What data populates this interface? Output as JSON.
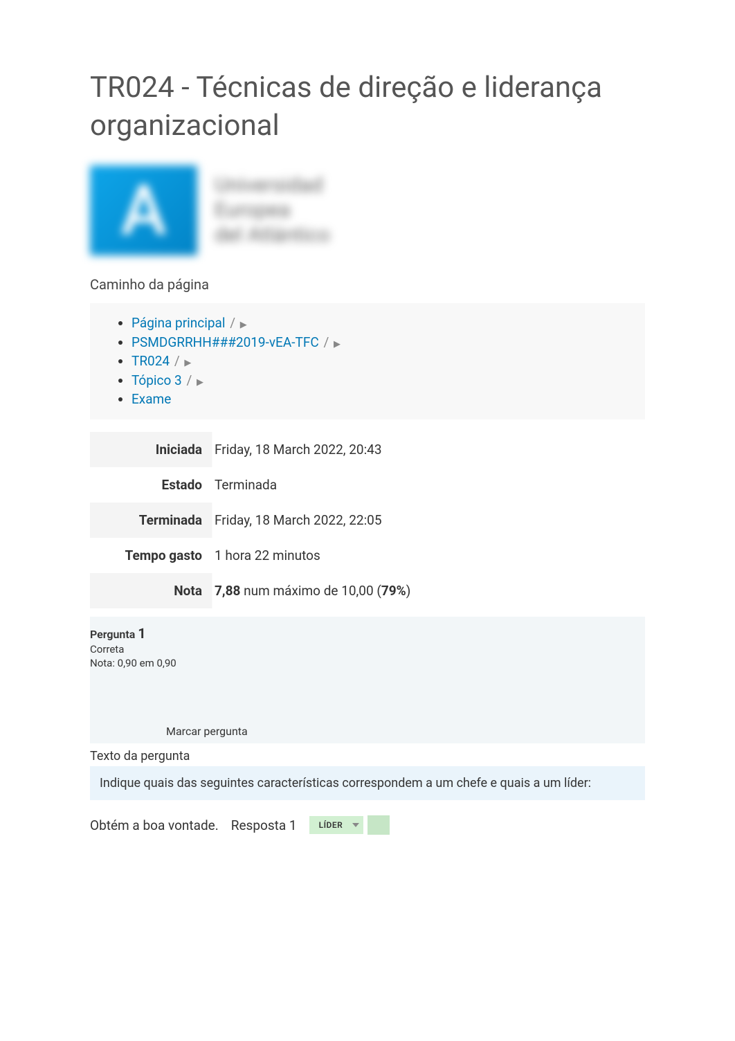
{
  "page_title": "TR024 - Técnicas de direção e liderança organizacional",
  "logo": {
    "letter": "A",
    "institution_line1": "Universidad",
    "institution_line2": "Europea",
    "institution_line3": "del Atlántico"
  },
  "breadcrumb": {
    "heading": "Caminho da página",
    "items": [
      {
        "label": "Página principal",
        "has_chevron": true
      },
      {
        "label": "PSMDGRRHH###2019-vEA-TFC",
        "has_chevron": true
      },
      {
        "label": "TR024",
        "has_chevron": true
      },
      {
        "label": "Tópico 3",
        "has_chevron": true
      },
      {
        "label": "Exame",
        "has_chevron": false
      }
    ]
  },
  "summary": {
    "rows": [
      {
        "label": "Iniciada",
        "value": "Friday, 18 March 2022, 20:43"
      },
      {
        "label": "Estado",
        "value": "Terminada"
      },
      {
        "label": "Terminada",
        "value": "Friday, 18 March 2022, 22:05"
      },
      {
        "label": "Tempo gasto",
        "value": "1 hora 22 minutos"
      }
    ],
    "grade_label": "Nota",
    "grade_value": "7,88",
    "grade_mid": " num máximo de 10,00 (",
    "grade_pct": "79%",
    "grade_close": ")"
  },
  "question": {
    "label": "Pergunta",
    "number": "1",
    "status": "Correta",
    "mark": "Nota: 0,90 em 0,90",
    "flag_label": "Marcar pergunta",
    "text_heading": "Texto da pergunta",
    "body": "Indique quais das seguintes características correspondem a um chefe e quais a um líder:",
    "answer_prompt": "Obtém a boa vontade.",
    "answer_label": "Resposta 1",
    "answer_selected": "LÍDER"
  }
}
